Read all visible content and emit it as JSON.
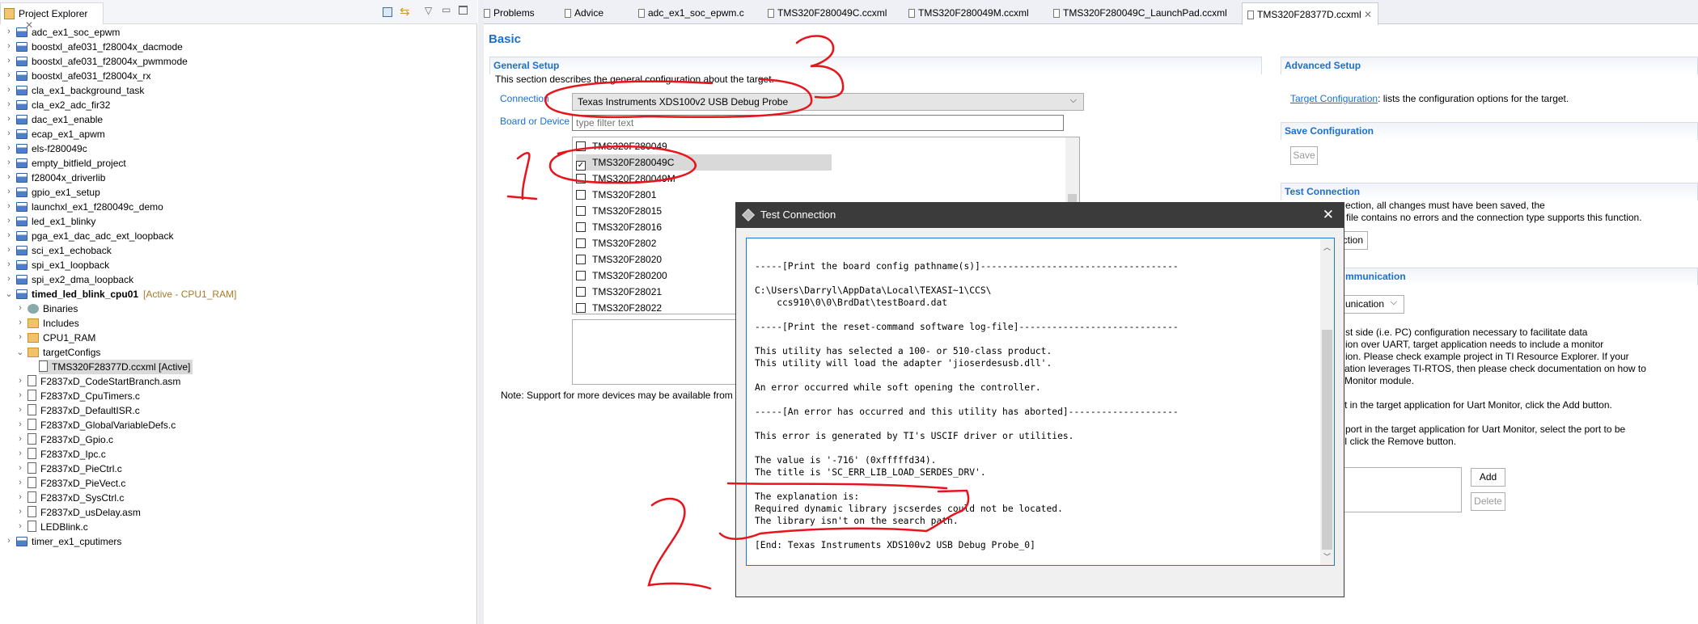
{
  "explorer": {
    "title": "Project Explorer",
    "items": [
      {
        "label": "adc_ex1_soc_epwm",
        "level": 0,
        "icon": "ccs-project-icon",
        "expander": "collapsed"
      },
      {
        "label": "boostxl_afe031_f28004x_dacmode",
        "level": 0,
        "icon": "ccs-project-icon",
        "expander": "collapsed"
      },
      {
        "label": "boostxl_afe031_f28004x_pwmmode",
        "level": 0,
        "icon": "ccs-project-icon",
        "expander": "collapsed"
      },
      {
        "label": "boostxl_afe031_f28004x_rx",
        "level": 0,
        "icon": "ccs-project-icon",
        "expander": "collapsed"
      },
      {
        "label": "cla_ex1_background_task",
        "level": 0,
        "icon": "ccs-project-warning-icon",
        "expander": "collapsed"
      },
      {
        "label": "cla_ex2_adc_fir32",
        "level": 0,
        "icon": "ccs-project-warning-icon",
        "expander": "collapsed"
      },
      {
        "label": "dac_ex1_enable",
        "level": 0,
        "icon": "ccs-project-icon",
        "expander": "collapsed"
      },
      {
        "label": "ecap_ex1_apwm",
        "level": 0,
        "icon": "ccs-project-icon",
        "expander": "collapsed"
      },
      {
        "label": "els-f280049c",
        "level": 0,
        "icon": "ccs-project-icon",
        "expander": "collapsed"
      },
      {
        "label": "empty_bitfield_project",
        "level": 0,
        "icon": "ccs-project-icon",
        "expander": "collapsed"
      },
      {
        "label": "f28004x_driverlib",
        "level": 0,
        "icon": "ccs-project-icon",
        "expander": "collapsed"
      },
      {
        "label": "gpio_ex1_setup",
        "level": 0,
        "icon": "ccs-project-icon",
        "expander": "collapsed"
      },
      {
        "label": "launchxl_ex1_f280049c_demo",
        "level": 0,
        "icon": "ccs-project-icon",
        "expander": "collapsed"
      },
      {
        "label": "led_ex1_blinky",
        "level": 0,
        "icon": "ccs-project-icon",
        "expander": "collapsed"
      },
      {
        "label": "pga_ex1_dac_adc_ext_loopback",
        "level": 0,
        "icon": "ccs-project-icon",
        "expander": "collapsed"
      },
      {
        "label": "sci_ex1_echoback",
        "level": 0,
        "icon": "ccs-project-icon",
        "expander": "collapsed"
      },
      {
        "label": "spi_ex1_loopback",
        "level": 0,
        "icon": "ccs-project-icon",
        "expander": "collapsed"
      },
      {
        "label": "spi_ex2_dma_loopback",
        "level": 0,
        "icon": "ccs-project-icon",
        "expander": "collapsed"
      },
      {
        "label": "timed_led_blink_cpu01",
        "suffix": "[Active - CPU1_RAM]",
        "level": 0,
        "icon": "ccs-project-warning-icon",
        "expander": "expanded",
        "bold": true
      },
      {
        "label": "Binaries",
        "level": 1,
        "icon": "binaries-icon",
        "expander": "collapsed"
      },
      {
        "label": "Includes",
        "level": 1,
        "icon": "includes-icon",
        "expander": "collapsed"
      },
      {
        "label": "CPU1_RAM",
        "level": 1,
        "icon": "folder-icon",
        "expander": "collapsed"
      },
      {
        "label": "targetConfigs",
        "level": 1,
        "icon": "folder-icon",
        "expander": "expanded"
      },
      {
        "label": "TMS320F28377D.ccxml [Active]",
        "level": 2,
        "icon": "ccxml-file-icon",
        "expander": "none",
        "selected": true
      },
      {
        "label": "F2837xD_CodeStartBranch.asm",
        "level": 1,
        "icon": "source-file-icon",
        "expander": "collapsed"
      },
      {
        "label": "F2837xD_CpuTimers.c",
        "level": 1,
        "icon": "source-file-icon",
        "expander": "collapsed"
      },
      {
        "label": "F2837xD_DefaultISR.c",
        "level": 1,
        "icon": "source-file-icon",
        "expander": "collapsed"
      },
      {
        "label": "F2837xD_GlobalVariableDefs.c",
        "level": 1,
        "icon": "source-file-icon",
        "expander": "collapsed"
      },
      {
        "label": "F2837xD_Gpio.c",
        "level": 1,
        "icon": "source-file-icon",
        "expander": "collapsed"
      },
      {
        "label": "F2837xD_Ipc.c",
        "level": 1,
        "icon": "source-file-icon",
        "expander": "collapsed"
      },
      {
        "label": "F2837xD_PieCtrl.c",
        "level": 1,
        "icon": "source-file-icon",
        "expander": "collapsed"
      },
      {
        "label": "F2837xD_PieVect.c",
        "level": 1,
        "icon": "source-file-icon",
        "expander": "collapsed"
      },
      {
        "label": "F2837xD_SysCtrl.c",
        "level": 1,
        "icon": "source-file-icon",
        "expander": "collapsed"
      },
      {
        "label": "F2837xD_usDelay.asm",
        "level": 1,
        "icon": "source-file-icon",
        "expander": "collapsed"
      },
      {
        "label": "LEDBlink.c",
        "level": 1,
        "icon": "source-file-icon",
        "expander": "collapsed"
      },
      {
        "label": "timer_ex1_cputimers",
        "level": 0,
        "icon": "ccs-project-icon",
        "expander": "collapsed"
      }
    ]
  },
  "editor_tabs": [
    {
      "label": "Problems",
      "icon": "problems-icon"
    },
    {
      "label": "Advice",
      "icon": "advice-bulb-icon"
    },
    {
      "label": "adc_ex1_soc_epwm.c",
      "icon": "c-file-icon"
    },
    {
      "label": "TMS320F280049C.ccxml",
      "icon": "ccxml-file-icon"
    },
    {
      "label": "TMS320F280049M.ccxml",
      "icon": "ccxml-file-icon"
    },
    {
      "label": "TMS320F280049C_LaunchPad.ccxml",
      "icon": "ccxml-file-icon"
    },
    {
      "label": "TMS320F28377D.ccxml",
      "icon": "ccxml-file-icon",
      "active": true
    }
  ],
  "page_title": "Basic",
  "general_setup": {
    "title": "General Setup",
    "description": "This section describes the general configuration about the target.",
    "connection_label": "Connection",
    "connection_value": "Texas Instruments XDS100v2 USB Debug Probe",
    "board_label": "Board or Device",
    "filter_placeholder": "type filter text",
    "devices": [
      {
        "name": "TMS320F280049",
        "checked": false
      },
      {
        "name": "TMS320F280049C",
        "checked": true,
        "selected": true
      },
      {
        "name": "TMS320F280049M",
        "checked": false
      },
      {
        "name": "TMS320F2801",
        "checked": false
      },
      {
        "name": "TMS320F28015",
        "checked": false
      },
      {
        "name": "TMS320F28016",
        "checked": false
      },
      {
        "name": "TMS320F2802",
        "checked": false
      },
      {
        "name": "TMS320F28020",
        "checked": false
      },
      {
        "name": "TMS320F280200",
        "checked": false
      },
      {
        "name": "TMS320F28021",
        "checked": false
      },
      {
        "name": "TMS320F28022",
        "checked": false
      }
    ],
    "note": "Note: Support for more devices may be available from t"
  },
  "advanced": {
    "title": "Advanced Setup",
    "link": "Target Configuration",
    "link_suffix": ": lists the configuration options for the target.",
    "save_title": "Save Configuration",
    "save_button": "Save",
    "test_title": "Test Connection",
    "test_lines": [
      "ection, all changes must have been saved, the",
      "file contains no errors and the connection type supports this function."
    ],
    "test_button_fragment": "ction",
    "comm_title_fragment": "mmunication",
    "comm_combo_fragment": "unication",
    "comm_lines": [
      "st side (i.e. PC) configuration necessary to facilitate data",
      "ion over UART, target application needs to include a monitor",
      "ion. Please check example project in TI Resource Explorer. If your",
      "ation leverages TI-RTOS, then please check documentation on how to",
      "Monitor module."
    ],
    "add_line": "t in the target application for Uart Monitor, click the Add button.",
    "remove_lines": [
      "port in the target application for Uart Monitor, select the port to be",
      "I click the Remove button."
    ],
    "add_button": "Add",
    "delete_button": "Delete"
  },
  "dialog": {
    "title": "Test Connection",
    "log": "\n-----[Print the board config pathname(s)]------------------------------------\n\nC:\\Users\\Darryl\\AppData\\Local\\TEXASI~1\\CCS\\\n    ccs910\\0\\0\\BrdDat\\testBoard.dat\n\n-----[Print the reset-command software log-file]-----------------------------\n\nThis utility has selected a 100- or 510-class product.\nThis utility will load the adapter 'jioserdesusb.dll'.\n\nAn error occurred while soft opening the controller.\n\n-----[An error has occurred and this utility has aborted]--------------------\n\nThis error is generated by TI's USCIF driver or utilities.\n\nThe value is '-716' (0xfffffd34).\nThe title is 'SC_ERR_LIB_LOAD_SERDES_DRV'.\n\nThe explanation is:\nRequired dynamic library jscserdes could not be located.\nThe library isn't on the search path.\n\n[End: Texas Instruments XDS100v2 USB Debug Probe_0]"
  },
  "colors": {
    "accent": "#1d6fce",
    "annotation": "#e8141b",
    "dialog_title_bg": "#3b3b3b",
    "active_label": "#a87a2a"
  }
}
